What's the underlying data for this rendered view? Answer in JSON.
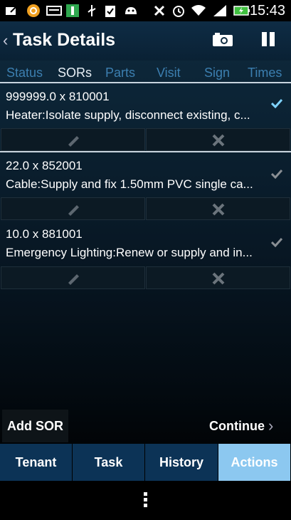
{
  "status_bar": {
    "time": "15:43",
    "icons": [
      "edit-icon",
      "notification-icon",
      "keyboard-icon",
      "app-i-icon",
      "usb-icon",
      "clipboard-check-icon",
      "android-icon",
      "no-sound-icon",
      "alarm-icon",
      "wifi-icon",
      "signal-icon",
      "battery-charging-icon"
    ]
  },
  "header": {
    "back_glyph": "‹",
    "title": "Task Details"
  },
  "tabs": [
    {
      "label": "Status"
    },
    {
      "label": "SORs"
    },
    {
      "label": "Parts"
    },
    {
      "label": "Visit"
    },
    {
      "label": "Sign"
    },
    {
      "label": "Times"
    }
  ],
  "active_tab": "SORs",
  "items": [
    {
      "line1": "999999.0 x 810001",
      "line2": "Heater:Isolate supply, disconnect existing, c...",
      "check_color": "#7fd3ff"
    },
    {
      "line1": "22.0 x 852001",
      "line2": "Cable:Supply and fix 1.50mm PVC single ca...",
      "check_color": "#8a8f94"
    },
    {
      "line1": "10.0 x 881001",
      "line2": "Emergency Lighting:Renew or supply and in...",
      "check_color": "#8a8f94"
    }
  ],
  "buttons": {
    "add_sor": "Add SOR",
    "continue": "Continue",
    "continue_glyph": "›"
  },
  "bottom_tabs": [
    {
      "label": "Tenant"
    },
    {
      "label": "Task"
    },
    {
      "label": "History"
    },
    {
      "label": "Actions"
    }
  ],
  "active_bottom_tab": "Actions",
  "colors": {
    "tab_inactive": "#3c7fb0",
    "tab_active": "#e8f0f6",
    "bottom_tab": "#0c3356",
    "bottom_tab_active": "#8cc8f0"
  }
}
